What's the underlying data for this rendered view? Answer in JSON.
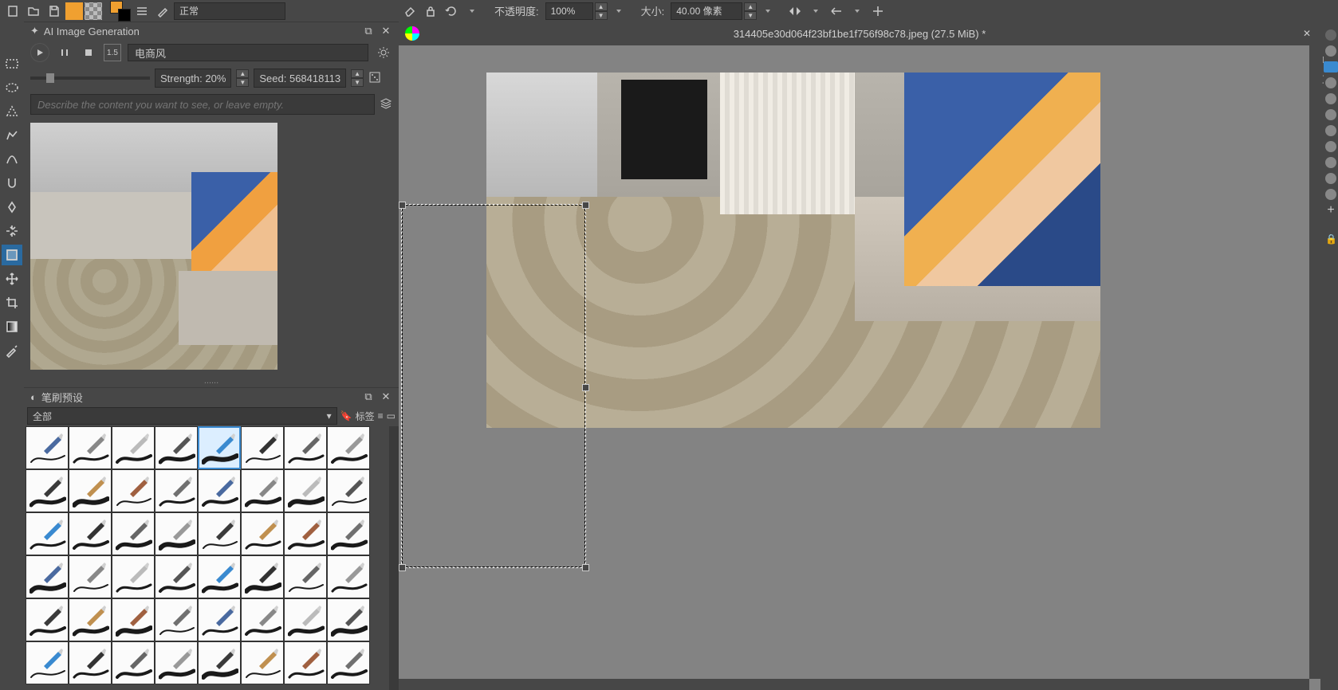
{
  "toolbar": {
    "blend_mode": "正常",
    "opacity_label": "不透明度:",
    "opacity_value": "100%",
    "size_label": "大小:",
    "size_value": "40.00 像素"
  },
  "ai_panel": {
    "title": "AI Image Generation",
    "style_value": "电商风",
    "style_tag": "1.5",
    "strength_label": "Strength: 20%",
    "seed_label": "Seed: 568418113",
    "prompt_placeholder": "Describe the content you want to see, or leave empty.",
    "dots": "......"
  },
  "brush_panel": {
    "title": "笔刷预设",
    "filter": "全部",
    "tag_label": "标签"
  },
  "tab": {
    "filename": "314405e30d064f23bf1be1f756f98c78.jpeg (27.5 MiB) *"
  },
  "tools": [
    "rect-select",
    "ellipse-select",
    "polygon-select",
    "freehand-select",
    "bezier-select",
    "magnetic-select",
    "contiguous-select",
    "similar-select",
    "transform",
    "move",
    "crop",
    "gradient",
    "color-picker"
  ],
  "brush_presets_count": 48,
  "selected_brush_index": 4
}
